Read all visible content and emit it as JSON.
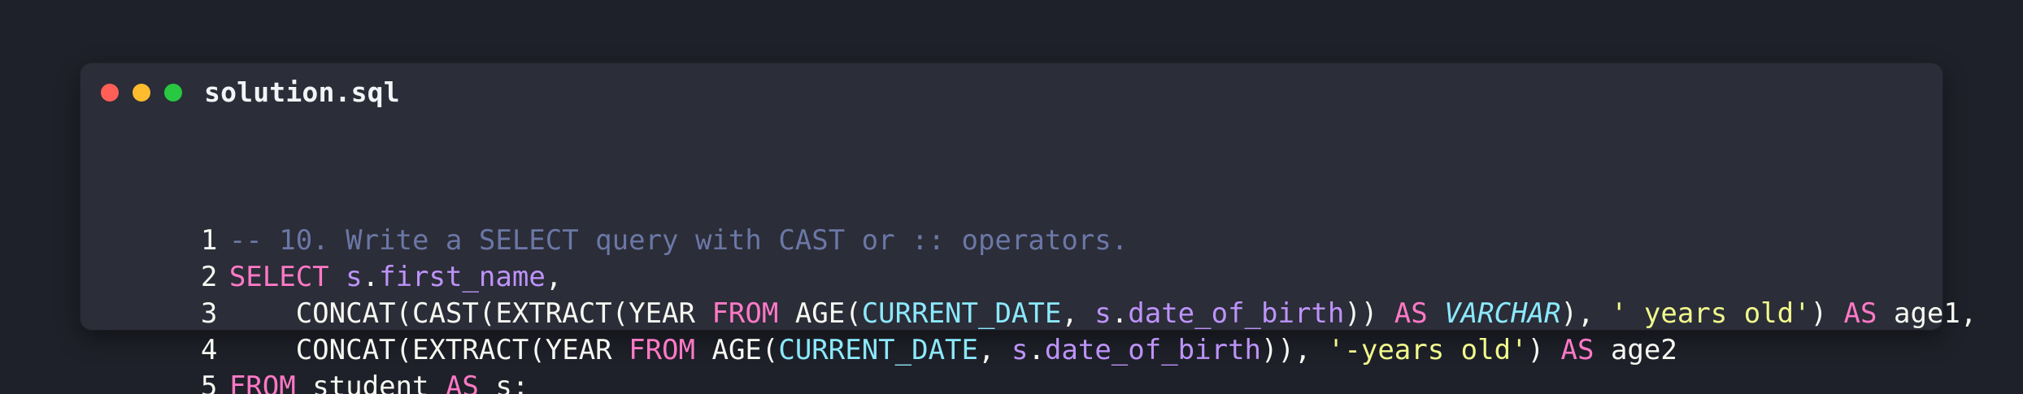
{
  "window": {
    "filename": "solution.sql",
    "traffic_lights": [
      {
        "name": "close",
        "color": "#ff5f57"
      },
      {
        "name": "minimize",
        "color": "#febc2e"
      },
      {
        "name": "zoom",
        "color": "#28c840"
      }
    ]
  },
  "colors": {
    "background": "#1f212a",
    "panel": "#2b2d38",
    "comment": "#6b77a6",
    "keyword": "#ff79c6",
    "identifier": "#bd93f9",
    "builtin": "#8be9fd",
    "string": "#f1fa8c",
    "text": "#f8f8f2"
  },
  "lines": [
    {
      "number": "1",
      "tokens": [
        {
          "text": "-- 10. Write a SELECT query with CAST or :: operators.",
          "cls": "cmt"
        }
      ]
    },
    {
      "number": "2",
      "tokens": [
        {
          "text": "SELECT",
          "cls": "kw"
        },
        {
          "text": " ",
          "cls": "plain"
        },
        {
          "text": "s",
          "cls": "ident"
        },
        {
          "text": ".",
          "cls": "plain"
        },
        {
          "text": "first_name",
          "cls": "ident"
        },
        {
          "text": ",",
          "cls": "plain"
        }
      ]
    },
    {
      "number": "3",
      "tokens": [
        {
          "text": "    CONCAT(CAST(EXTRACT(YEAR ",
          "cls": "func"
        },
        {
          "text": "FROM",
          "cls": "kw"
        },
        {
          "text": " AGE(",
          "cls": "func"
        },
        {
          "text": "CURRENT_DATE",
          "cls": "builtin"
        },
        {
          "text": ", ",
          "cls": "plain"
        },
        {
          "text": "s",
          "cls": "ident"
        },
        {
          "text": ".",
          "cls": "plain"
        },
        {
          "text": "date_of_birth",
          "cls": "ident"
        },
        {
          "text": ")) ",
          "cls": "plain"
        },
        {
          "text": "AS",
          "cls": "kw"
        },
        {
          "text": " ",
          "cls": "plain"
        },
        {
          "text": "VARCHAR",
          "cls": "type"
        },
        {
          "text": "), ",
          "cls": "plain"
        },
        {
          "text": "' years old'",
          "cls": "str"
        },
        {
          "text": ") ",
          "cls": "plain"
        },
        {
          "text": "AS",
          "cls": "kw"
        },
        {
          "text": " age1,",
          "cls": "plain"
        }
      ]
    },
    {
      "number": "4",
      "tokens": [
        {
          "text": "    CONCAT(EXTRACT(YEAR ",
          "cls": "func"
        },
        {
          "text": "FROM",
          "cls": "kw"
        },
        {
          "text": " AGE(",
          "cls": "func"
        },
        {
          "text": "CURRENT_DATE",
          "cls": "builtin"
        },
        {
          "text": ", ",
          "cls": "plain"
        },
        {
          "text": "s",
          "cls": "ident"
        },
        {
          "text": ".",
          "cls": "plain"
        },
        {
          "text": "date_of_birth",
          "cls": "ident"
        },
        {
          "text": ")), ",
          "cls": "plain"
        },
        {
          "text": "'-years old'",
          "cls": "str"
        },
        {
          "text": ") ",
          "cls": "plain"
        },
        {
          "text": "AS",
          "cls": "kw"
        },
        {
          "text": " age2",
          "cls": "plain"
        }
      ]
    },
    {
      "number": "5",
      "tokens": [
        {
          "text": "FROM",
          "cls": "kw"
        },
        {
          "text": " student ",
          "cls": "plain"
        },
        {
          "text": "AS",
          "cls": "kw"
        },
        {
          "text": " s;",
          "cls": "plain"
        }
      ]
    }
  ]
}
